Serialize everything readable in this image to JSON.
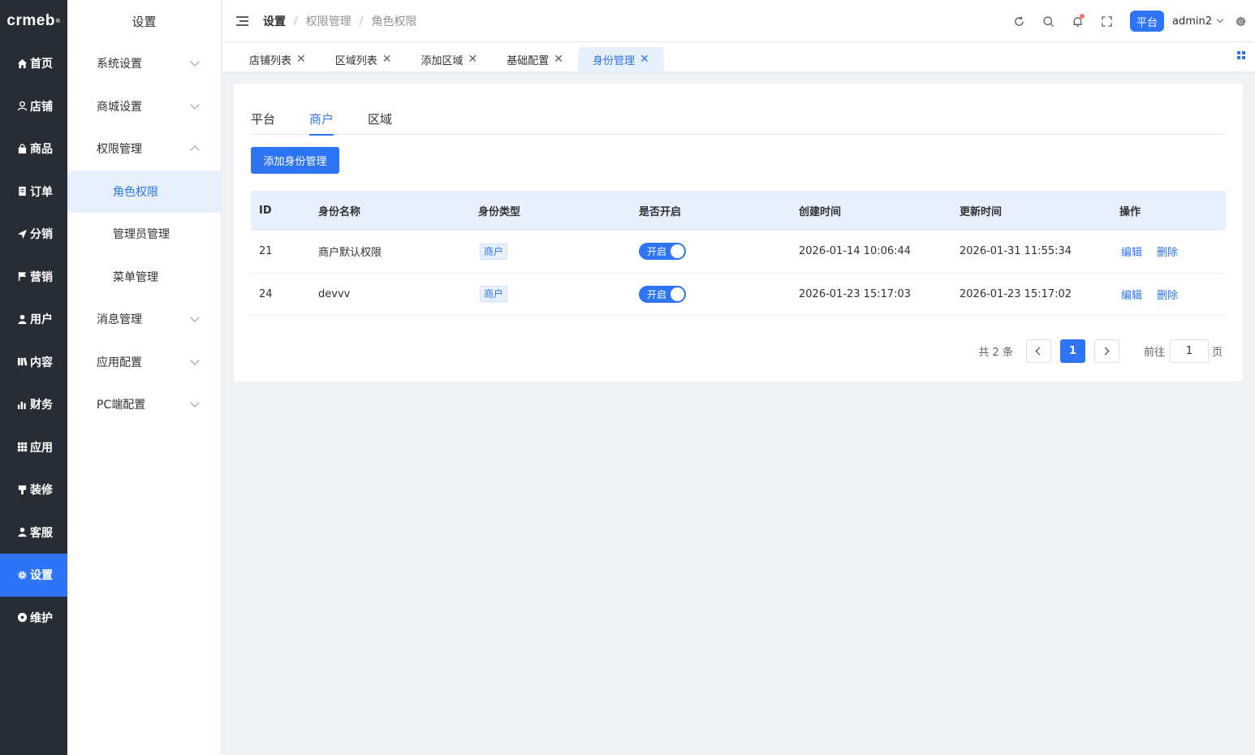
{
  "logo": {
    "text": "crmeb",
    "mark": "®"
  },
  "nav": [
    {
      "label": "首页",
      "icon": "home-icon",
      "active": false
    },
    {
      "label": "店铺",
      "icon": "store-icon",
      "active": false
    },
    {
      "label": "商品",
      "icon": "bag-icon",
      "active": false
    },
    {
      "label": "订单",
      "icon": "order-icon",
      "active": false
    },
    {
      "label": "分销",
      "icon": "send-icon",
      "active": false
    },
    {
      "label": "营销",
      "icon": "flag-icon",
      "active": false
    },
    {
      "label": "用户",
      "icon": "user-icon",
      "active": false
    },
    {
      "label": "内容",
      "icon": "content-icon",
      "active": false
    },
    {
      "label": "财务",
      "icon": "chart-icon",
      "active": false
    },
    {
      "label": "应用",
      "icon": "grid-icon",
      "active": false
    },
    {
      "label": "装修",
      "icon": "brush-icon",
      "active": false
    },
    {
      "label": "客服",
      "icon": "service-icon",
      "active": false
    },
    {
      "label": "设置",
      "icon": "gear-icon",
      "active": true
    },
    {
      "label": "维护",
      "icon": "maintain-icon",
      "active": false
    }
  ],
  "submenu": {
    "title": "设置",
    "items": [
      {
        "label": "系统设置"
      },
      {
        "label": "商城设置"
      },
      {
        "label": "权限管理"
      },
      {
        "label": "角色权限"
      },
      {
        "label": "管理员管理"
      },
      {
        "label": "菜单管理"
      },
      {
        "label": "消息管理"
      },
      {
        "label": "应用配置"
      },
      {
        "label": "PC端配置"
      }
    ]
  },
  "breadcrumb": {
    "b1": "设置",
    "sep": "/",
    "b2": "权限管理",
    "b3": "角色权限"
  },
  "header": {
    "platform": "平台",
    "user": "admin2"
  },
  "page_tabs": [
    {
      "label": "店铺列表"
    },
    {
      "label": "区域列表"
    },
    {
      "label": "添加区域"
    },
    {
      "label": "基础配置"
    },
    {
      "label": "身份管理"
    }
  ],
  "close_glyph": "✕",
  "content_tabs": [
    {
      "label": "平台"
    },
    {
      "label": "商户"
    },
    {
      "label": "区域"
    }
  ],
  "add_button": "添加身份管理",
  "table": {
    "headers": [
      "ID",
      "身份名称",
      "身份类型",
      "是否开启",
      "创建时间",
      "更新时间",
      "操作"
    ],
    "rows": [
      {
        "id": "21",
        "name": "商户默认权限",
        "type": "商户",
        "switch": "开启",
        "created": "2026-01-14 10:06:44",
        "updated": "2026-01-31 11:55:34",
        "edit": "编辑",
        "del": "删除"
      },
      {
        "id": "24",
        "name": "devvv",
        "type": "商户",
        "switch": "开启",
        "created": "2026-01-23 15:17:03",
        "updated": "2026-01-23 15:17:02",
        "edit": "编辑",
        "del": "删除"
      }
    ]
  },
  "pagination": {
    "total": "共 2 条",
    "current": "1",
    "goto": "前往",
    "page_value": "1",
    "page_suffix": "页"
  },
  "colors": {
    "primary": "#2d74f6",
    "nav_bg": "#282c34",
    "page_bg": "#f0f2f5"
  }
}
